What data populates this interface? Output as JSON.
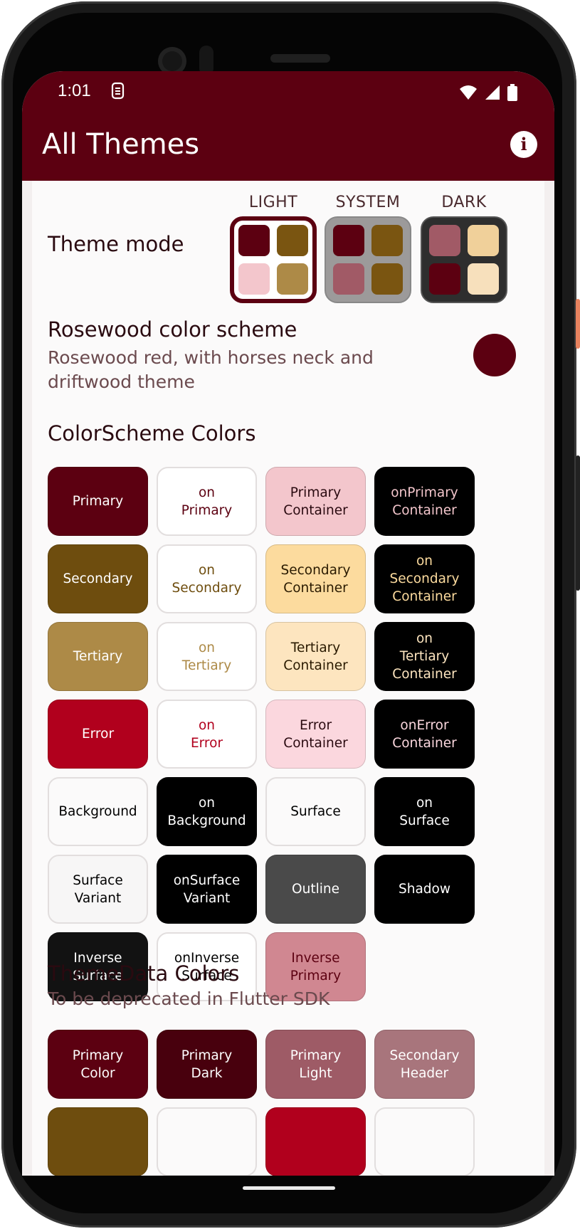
{
  "status_bar": {
    "time": "1:01"
  },
  "app_bar": {
    "title": "All Themes"
  },
  "theme_mode": {
    "label": "Theme mode",
    "options": [
      {
        "label": "LIGHT",
        "selected": true
      },
      {
        "label": "SYSTEM",
        "selected": false
      },
      {
        "label": "DARK",
        "selected": false
      }
    ]
  },
  "scheme": {
    "title": "Rosewood color scheme",
    "description": "Rosewood red, with horses neck and driftwood theme",
    "color": "#5c0011"
  },
  "colorscheme_section": {
    "title": "ColorScheme Colors",
    "swatches": [
      {
        "label": "Primary",
        "bg": "#5c0011",
        "fg": "#ffffff"
      },
      {
        "label": "on\nPrimary",
        "bg": "#ffffff",
        "fg": "#5c0011"
      },
      {
        "label": "Primary\nContainer",
        "bg": "#f3c6cc",
        "fg": "#2a0a10"
      },
      {
        "label": "onPrimary\nContainer",
        "bg": "#000000",
        "fg": "#f3c6cc"
      },
      {
        "label": "Secondary",
        "bg": "#6e4d0e",
        "fg": "#ffffff"
      },
      {
        "label": "on\nSecondary",
        "bg": "#ffffff",
        "fg": "#6e4d0e"
      },
      {
        "label": "Secondary\nContainer",
        "bg": "#fcdb9e",
        "fg": "#2a1a00"
      },
      {
        "label": "on\nSecondary\nContainer",
        "bg": "#000000",
        "fg": "#fcdb9e"
      },
      {
        "label": "Tertiary",
        "bg": "#ad8a47",
        "fg": "#ffffff"
      },
      {
        "label": "on\nTertiary",
        "bg": "#ffffff",
        "fg": "#ad8a47"
      },
      {
        "label": "Tertiary\nContainer",
        "bg": "#fde5bf",
        "fg": "#2a1a00"
      },
      {
        "label": "on\nTertiary\nContainer",
        "bg": "#000000",
        "fg": "#fde5bf"
      },
      {
        "label": "Error",
        "bg": "#b1001d",
        "fg": "#ffffff"
      },
      {
        "label": "on\nError",
        "bg": "#ffffff",
        "fg": "#b1001d"
      },
      {
        "label": "Error\nContainer",
        "bg": "#fbd7de",
        "fg": "#2a0a10"
      },
      {
        "label": "onError\nContainer",
        "bg": "#000000",
        "fg": "#fbd7de"
      },
      {
        "label": "Background",
        "bg": "#fbfafa",
        "fg": "#000000"
      },
      {
        "label": "on\nBackground",
        "bg": "#000000",
        "fg": "#ffffff"
      },
      {
        "label": "Surface",
        "bg": "#fbfafa",
        "fg": "#000000"
      },
      {
        "label": "on\nSurface",
        "bg": "#000000",
        "fg": "#ffffff"
      },
      {
        "label": "Surface\nVariant",
        "bg": "#f7f6f6",
        "fg": "#000000"
      },
      {
        "label": "onSurface\nVariant",
        "bg": "#000000",
        "fg": "#ffffff"
      },
      {
        "label": "Outline",
        "bg": "#4a4a4a",
        "fg": "#ffffff"
      },
      {
        "label": "Shadow",
        "bg": "#000000",
        "fg": "#ffffff"
      },
      {
        "label": "Inverse\nSurface",
        "bg": "#121212",
        "fg": "#ffffff"
      },
      {
        "label": "onInverse\nSurface",
        "bg": "#ffffff",
        "fg": "#000000"
      },
      {
        "label": "Inverse\nPrimary",
        "bg": "#d08791",
        "fg": "#5c0011"
      }
    ]
  },
  "themedata_section": {
    "title": "ThemeData Colors",
    "subtitle": "To be deprecated in Flutter SDK",
    "swatches": [
      {
        "label": "Primary\nColor",
        "bg": "#5c0011",
        "fg": "#ffffff"
      },
      {
        "label": "Primary\nDark",
        "bg": "#48000d",
        "fg": "#ffffff"
      },
      {
        "label": "Primary\nLight",
        "bg": "#9e5b66",
        "fg": "#ffffff"
      },
      {
        "label": "Secondary\nHeader",
        "bg": "#a8757c",
        "fg": "#ffffff"
      },
      {
        "label": "",
        "bg": "#6e4d0e",
        "fg": "#ffffff"
      },
      {
        "label": "",
        "bg": "#fbfafa",
        "fg": "#000000"
      },
      {
        "label": "",
        "bg": "#b1001d",
        "fg": "#ffffff"
      },
      {
        "label": "",
        "bg": "#fbfafa",
        "fg": "#000000"
      }
    ]
  }
}
